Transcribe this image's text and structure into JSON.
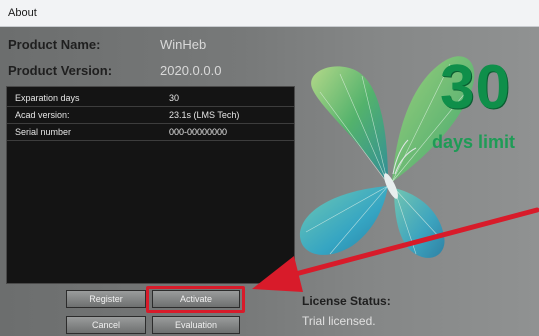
{
  "window": {
    "title": "About"
  },
  "product": {
    "name_label": "Product Name:",
    "name_value": "WinHeb",
    "version_label": "Product Version:",
    "version_value": "2020.0.0.0"
  },
  "info_table": {
    "rows": [
      {
        "key": "Exparation days",
        "value": "30"
      },
      {
        "key": "Acad version:",
        "value": "23.1s (LMS Tech)"
      },
      {
        "key": "Serial number",
        "value": "000-00000000"
      }
    ]
  },
  "buttons": {
    "register": "Register",
    "activate": "Activate",
    "cancel": "Cancel",
    "evaluation": "Evaluation"
  },
  "trial": {
    "days": "30",
    "days_label": "days limit"
  },
  "license": {
    "status_label": "License Status:",
    "status_value": "Trial licensed."
  },
  "colors": {
    "accent_green": "#0f8f4a",
    "annotation_red": "#d81b2a",
    "panel_bg": "#141414"
  },
  "icons": {
    "logo": "butterfly-icon",
    "annotation": "arrow-annotation"
  }
}
